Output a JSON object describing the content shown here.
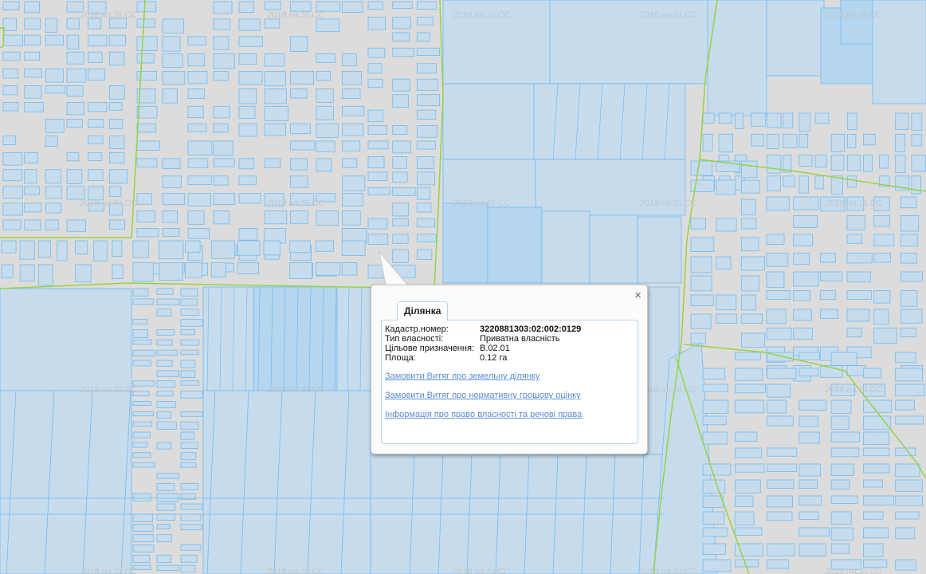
{
  "map": {
    "watermark": "2018.на.SLCC",
    "colors": {
      "background": "#dcdcdc",
      "parcel_fill": "#c6dced",
      "parcel_fill_dark": "#b4d6ee",
      "parcel_stroke": "#72bbf0",
      "boundary": "#95d345"
    }
  },
  "popup": {
    "close_label": "×",
    "tab_label": "Ділянка",
    "fields": [
      {
        "key": "Кадастр.номер:",
        "value": "3220881303:02:002:0129"
      },
      {
        "key": "Тип власності:",
        "value": "Приватна власність"
      },
      {
        "key": "Цільове призначення:",
        "value": "В.02.01"
      },
      {
        "key": "Площа:",
        "value": "0.12 га"
      }
    ],
    "links": [
      "Замовити Витяг про земельну ділянку",
      "Замовити Витяг про нормативну грошову оцінку",
      "Інформація про право власності та речові права"
    ]
  }
}
